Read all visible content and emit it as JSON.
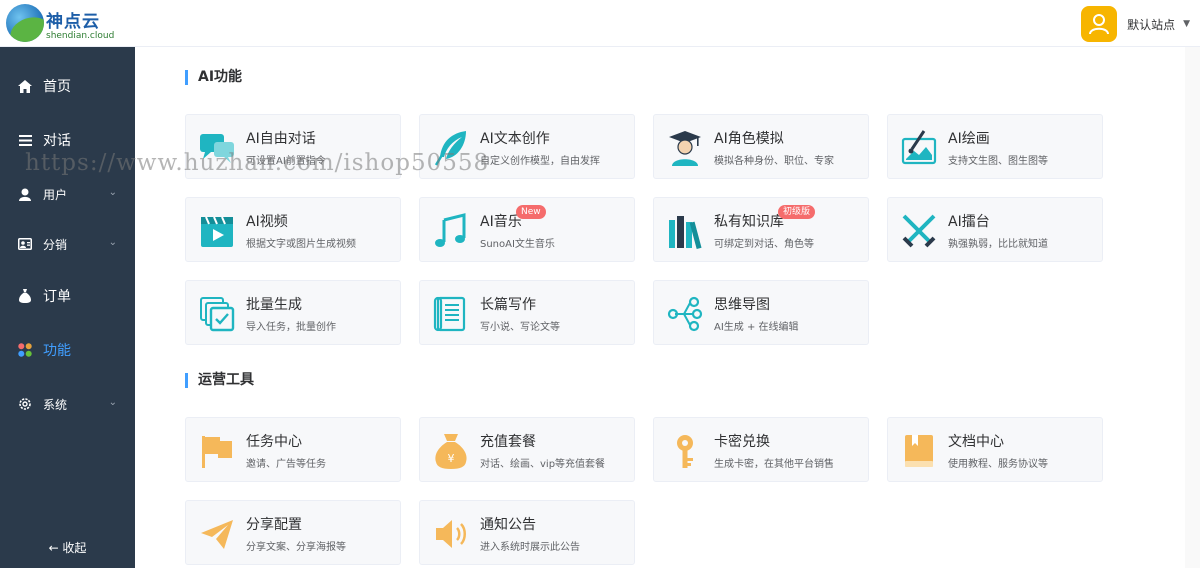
{
  "header": {
    "logo_title": "神点云",
    "logo_sub": "shendian.cloud",
    "site_name": "默认站点",
    "caret": "▼"
  },
  "sidebar": {
    "items": [
      {
        "label": "首页",
        "icon": "home-icon"
      },
      {
        "label": "对话",
        "icon": "menu-icon"
      },
      {
        "label": "用户",
        "icon": "user-icon",
        "chevron": "⌄"
      },
      {
        "label": "分销",
        "icon": "distribution-icon",
        "chevron": "⌄"
      },
      {
        "label": "订单",
        "icon": "money-bag-icon"
      },
      {
        "label": "功能",
        "icon": "apps-icon",
        "active": true
      },
      {
        "label": "系统",
        "icon": "gear-icon",
        "chevron": "⌄"
      }
    ],
    "collapse_label": "← 收起"
  },
  "sections": [
    {
      "title": "AI功能",
      "cards": [
        {
          "title": "AI自由对话",
          "desc": "可设置AI前置指令",
          "icon": "chat-icon"
        },
        {
          "title": "AI文本创作",
          "desc": "自定义创作模型，自由发挥",
          "icon": "feather-icon"
        },
        {
          "title": "AI角色模拟",
          "desc": "模拟各种身份、职位、专家",
          "icon": "graduate-icon"
        },
        {
          "title": "AI绘画",
          "desc": "支持文生图、图生图等",
          "icon": "painting-icon"
        },
        {
          "title": "AI视频",
          "desc": "根据文字或图片生成视频",
          "icon": "video-icon"
        },
        {
          "title": "AI音乐",
          "desc": "SunoAI文生音乐",
          "icon": "music-icon",
          "badge": "New"
        },
        {
          "title": "私有知识库",
          "desc": "可绑定到对话、角色等",
          "icon": "books-icon",
          "badge": "初级版"
        },
        {
          "title": "AI擂台",
          "desc": "孰强孰弱，比比就知道",
          "icon": "swords-icon"
        },
        {
          "title": "批量生成",
          "desc": "导入任务，批量创作",
          "icon": "batch-icon"
        },
        {
          "title": "长篇写作",
          "desc": "写小说、写论文等",
          "icon": "scroll-icon"
        },
        {
          "title": "思维导图",
          "desc": "AI生成 + 在线编辑",
          "icon": "mindmap-icon"
        }
      ]
    },
    {
      "title": "运营工具",
      "cards": [
        {
          "title": "任务中心",
          "desc": "邀请、广告等任务",
          "icon": "flag-icon"
        },
        {
          "title": "充值套餐",
          "desc": "对话、绘画、vip等充值套餐",
          "icon": "money-bag-icon"
        },
        {
          "title": "卡密兑换",
          "desc": "生成卡密，在其他平台销售",
          "icon": "key-icon"
        },
        {
          "title": "文档中心",
          "desc": "使用教程、服务协议等",
          "icon": "book-icon"
        },
        {
          "title": "分享配置",
          "desc": "分享文案、分享海报等",
          "icon": "paper-plane-icon"
        },
        {
          "title": "通知公告",
          "desc": "进入系统时展示此公告",
          "icon": "speaker-icon"
        }
      ]
    }
  ],
  "watermark": "https://www.huzhan.com/ishop50558",
  "colors": {
    "sidebar_bg": "#2b3a4b",
    "active": "#409eff",
    "teal_icon": "#1fb5c1",
    "orange_icon": "#f5b85a",
    "badge": "#f56c6c",
    "avatar": "#f7b500"
  }
}
